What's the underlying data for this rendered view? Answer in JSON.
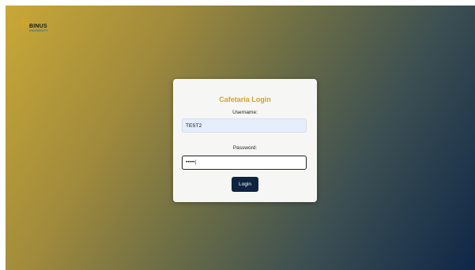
{
  "brand": {
    "name": "BINUS",
    "subtitle": "UNIVERSITY"
  },
  "login": {
    "title": "Cafetaria Login",
    "username_label": "Username:",
    "username_value": "TEST2",
    "password_label": "Password:",
    "password_value": "•••••|",
    "button_label": "Login"
  },
  "colors": {
    "title": "#d1a32c",
    "button": "#0e2340",
    "gradient_start": "#c9a837",
    "gradient_end": "#0f2748"
  }
}
